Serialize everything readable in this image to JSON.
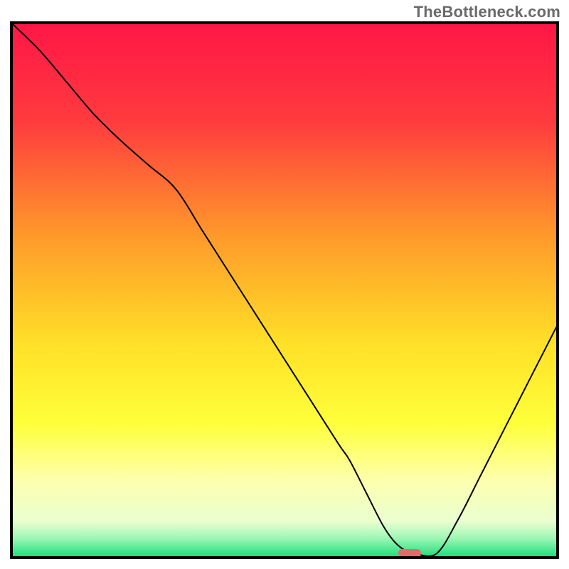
{
  "watermark": "TheBottleneck.com",
  "chart_data": {
    "type": "line",
    "title": "",
    "xlabel": "",
    "ylabel": "",
    "xlim": [
      0,
      100
    ],
    "ylim": [
      0,
      100
    ],
    "grid": false,
    "background_gradient": {
      "stops": [
        {
          "offset": 0.0,
          "color": "#ff1746"
        },
        {
          "offset": 0.18,
          "color": "#ff3a3f"
        },
        {
          "offset": 0.4,
          "color": "#ff9a2a"
        },
        {
          "offset": 0.6,
          "color": "#ffe028"
        },
        {
          "offset": 0.75,
          "color": "#ffff3a"
        },
        {
          "offset": 0.86,
          "color": "#fdffb0"
        },
        {
          "offset": 0.935,
          "color": "#e9ffcf"
        },
        {
          "offset": 0.965,
          "color": "#a1f7b6"
        },
        {
          "offset": 1.0,
          "color": "#21e07e"
        }
      ]
    },
    "series": [
      {
        "name": "bottleneck-curve",
        "x": [
          0,
          5,
          10,
          15,
          20,
          25,
          30,
          35,
          40,
          45,
          50,
          55,
          60,
          62,
          65,
          68,
          70,
          72,
          74,
          78,
          82,
          86,
          90,
          94,
          98,
          100
        ],
        "y": [
          100,
          95,
          89,
          83,
          78,
          73.5,
          69,
          61,
          53,
          45,
          37,
          29,
          21,
          18,
          12,
          6,
          3,
          1.2,
          0.5,
          0.5,
          7,
          15,
          23,
          31,
          39,
          43
        ]
      }
    ],
    "marker": {
      "name": "optimal-marker",
      "x": 73,
      "y": 0.6,
      "shape": "pill",
      "color": "#e26a6a",
      "width_pct": 4.2,
      "height_pct": 1.6
    },
    "legend": null
  }
}
